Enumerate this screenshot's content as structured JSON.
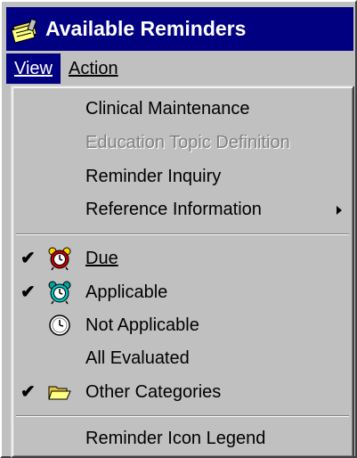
{
  "window": {
    "title": "Available Reminders"
  },
  "menubar": {
    "items": [
      {
        "label": "View",
        "active": true
      },
      {
        "label": "Action",
        "active": false
      }
    ]
  },
  "view_menu": {
    "items": [
      {
        "label": "Clinical Maintenance",
        "enabled": true
      },
      {
        "label": "Education Topic Definition",
        "enabled": false
      },
      {
        "label": "Reminder Inquiry",
        "enabled": true
      },
      {
        "label": "Reference Information",
        "enabled": true,
        "submenu": true
      },
      {
        "label": "Due",
        "checked": true,
        "icon": "alarm-clock-red-icon"
      },
      {
        "label": "Applicable",
        "checked": true,
        "icon": "alarm-clock-teal-icon"
      },
      {
        "label": "Not Applicable",
        "checked": false,
        "icon": "clock-icon"
      },
      {
        "label": "All Evaluated",
        "checked": false
      },
      {
        "label": "Other Categories",
        "checked": true,
        "icon": "folder-open-icon"
      },
      {
        "label": "Reminder Icon Legend",
        "enabled": true
      }
    ],
    "check_mark": "✔"
  }
}
